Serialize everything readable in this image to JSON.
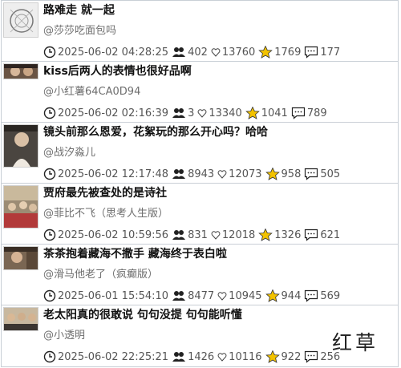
{
  "posts": [
    {
      "title": "路难走 就一起",
      "author": "@莎莎吃面包吗",
      "time": "2025-06-02 04:28:25",
      "viewers": "402",
      "likes": "13760",
      "stars": "1769",
      "comments": "177"
    },
    {
      "title": "kiss后两人的表情也很好品啊",
      "author": "@小红薯64CA0D94",
      "time": "2025-06-02 02:16:39",
      "viewers": "3",
      "likes": "13340",
      "stars": "1041",
      "comments": "789"
    },
    {
      "title": "镜头前那么恩爱，花絮玩的那么开心吗？哈哈",
      "author": "@战汐淼儿",
      "time": "2025-06-02 12:17:48",
      "viewers": "8943",
      "likes": "12073",
      "stars": "958",
      "comments": "505"
    },
    {
      "title": "贾府最先被查处的是诗社",
      "author": "@菲比不飞（思考人生版）",
      "time": "2025-06-02 10:59:56",
      "viewers": "831",
      "likes": "12018",
      "stars": "1326",
      "comments": "621"
    },
    {
      "title": "茶茶抱着藏海不撒手 藏海终于表白啦",
      "author": "@滑马他老了（疯癫版）",
      "time": "2025-06-01 15:54:10",
      "viewers": "8477",
      "likes": "10945",
      "stars": "944",
      "comments": "569"
    },
    {
      "title": "老太阳真的很敢说 句句没提 句句能听懂",
      "author": "@小透明",
      "time": "2025-06-02 22:25:21",
      "viewers": "1426",
      "likes": "10116",
      "stars": "922",
      "comments": "256"
    }
  ],
  "watermark": "红草",
  "colors": {
    "star": "#f2c200",
    "border": "#c9cfd6",
    "author": "#6e6e6e"
  }
}
